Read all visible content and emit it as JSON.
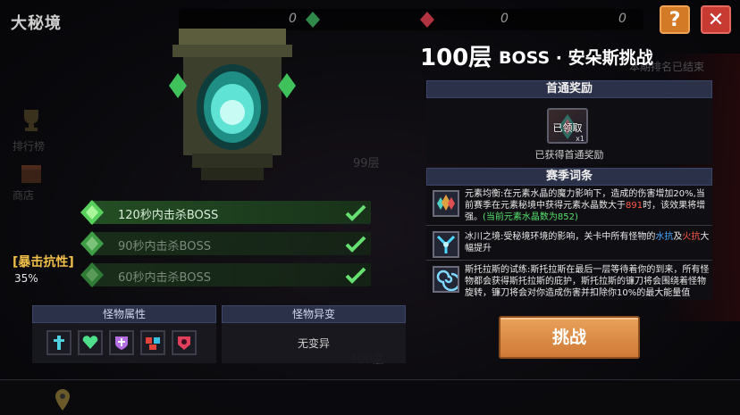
{
  "page": {
    "title": "大秘境",
    "floor": "100层",
    "boss_title": "BOSS · 安朵斯挑战"
  },
  "topbar": {
    "counters": [
      "0",
      "0",
      "0"
    ]
  },
  "background_text": {
    "season_ended": "本期排名已结束",
    "ranking_tab": "排行榜",
    "shop_tab": "商店",
    "floor_99": "99层",
    "floor_100": "100层"
  },
  "conditions": [
    {
      "label": "120秒内击杀BOSS",
      "completed": true
    },
    {
      "label": "90秒内击杀BOSS",
      "completed": true
    },
    {
      "label": "60秒内击杀BOSS",
      "completed": true
    }
  ],
  "crit_resist": {
    "label": "[暴击抗性]",
    "value": "35%"
  },
  "monster_attributes": {
    "header": "怪物属性",
    "icons": [
      "sword-shield-icon",
      "heart-icon",
      "cross-shield-icon",
      "scales-icon",
      "skull-icon"
    ]
  },
  "monster_mutation": {
    "header": "怪物异变",
    "value": "无变异"
  },
  "first_clear": {
    "header": "首通奖励",
    "badge": "已领取",
    "quantity": "x1",
    "note": "已获得首通奖励"
  },
  "season_affixes": {
    "header": "赛季词条",
    "items": [
      {
        "icon": "crystal-icon",
        "text_a": "元素均衡:在元素水晶的魔力影响下，造成的伤害增加20%,当前赛季在元素秘境中获得元素水晶数大于",
        "highlight": "891",
        "text_b": "时，该效果将增强。",
        "note": "(当前元素水晶数为852)"
      },
      {
        "icon": "ice-icon",
        "text_a": "冰川之境:受秘境环境的影响，关卡中所有怪物的",
        "water": "水抗",
        "and": "及",
        "fire": "火抗",
        "text_b": "大幅提升"
      },
      {
        "icon": "spiral-icon",
        "text": "斯托拉斯的试练:斯托拉斯在最后一层等待着你的到来，所有怪物都会获得斯托拉斯的庇护，斯托拉斯的镰刀将会围绕着怪物旋转，镰刀将会对你造成伤害并扣除你10%的最大能量值"
      }
    ]
  },
  "challenge_button": "挑战",
  "colors": {
    "accent_orange": "#d27a25",
    "close_red": "#c83b32",
    "panel_header": "#2a3148",
    "check_green": "#55e06a"
  }
}
